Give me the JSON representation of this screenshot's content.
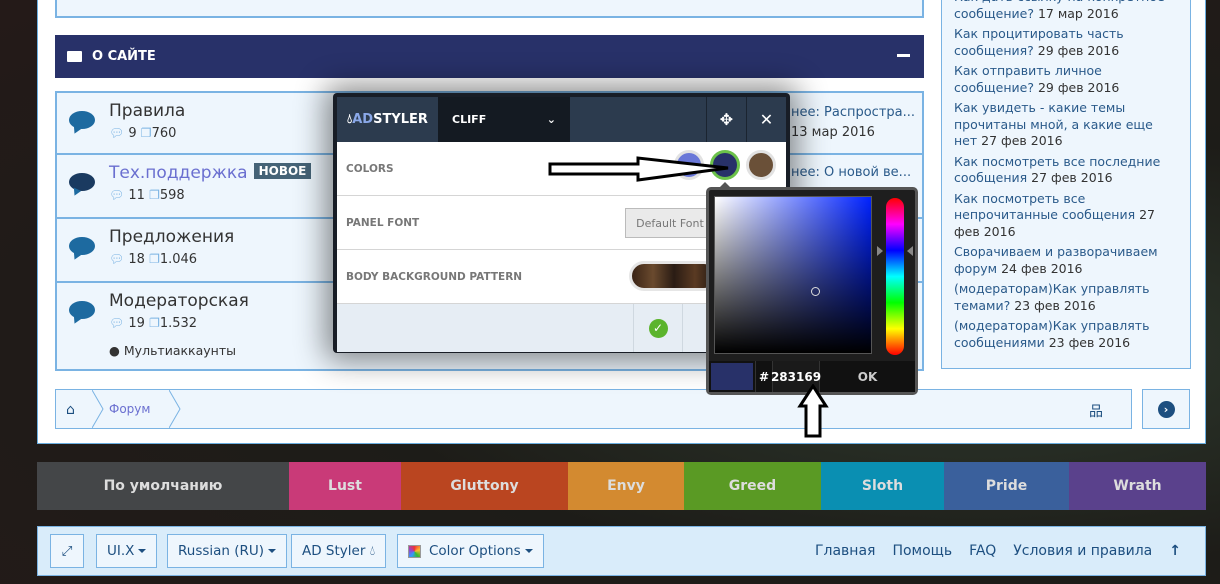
{
  "category": {
    "title": "О САЙТЕ"
  },
  "forums": [
    {
      "title": "Правила",
      "threads": "9",
      "posts": "760",
      "last": "нее: Распростра...",
      "date": "13 мар 2016"
    },
    {
      "title": "Тех.поддержка",
      "badge": "НОВОЕ",
      "threads": "11",
      "posts": "598",
      "last": "нее: О новой ве..."
    },
    {
      "title": "Предложения",
      "threads": "18",
      "posts": "1.046"
    },
    {
      "title": "Модераторская",
      "threads": "19",
      "posts": "1.532",
      "subforum": "Мультиаккаунты"
    }
  ],
  "sidebar": [
    {
      "title": "Как дать ссылку на конкретное сообщение?",
      "date": "17 мар 2016"
    },
    {
      "title": "Как процитировать часть сообщения?",
      "date": "29 фев 2016"
    },
    {
      "title": "Как отправить личное сообщение?",
      "date": "29 фев 2016"
    },
    {
      "title": "Как увидеть - какие темы прочитаны мной, а какие еще нет",
      "date": "27 фев 2016"
    },
    {
      "title": "Как посмотреть все последние сообщения",
      "date": "27 фев 2016"
    },
    {
      "title": "Как посмотреть все непрочитанные сообщения",
      "date": "27 фев 2016"
    },
    {
      "title": "Сворачиваем и разворачиваем форум",
      "date": "24 фев 2016"
    },
    {
      "title": "(модераторам)Как управлять темами?",
      "date": "23 фев 2016"
    },
    {
      "title": "(модераторам)Как управлять сообщениями",
      "date": "23 фев 2016"
    }
  ],
  "breadcrumb": {
    "item": "Форум"
  },
  "styles": [
    {
      "label": "По умолчанию",
      "color": "#444648"
    },
    {
      "label": "Lust",
      "color": "#c93a78"
    },
    {
      "label": "Gluttony",
      "color": "#ba4520"
    },
    {
      "label": "Envy",
      "color": "#d38a30"
    },
    {
      "label": "Greed",
      "color": "#5a9a24"
    },
    {
      "label": "Sloth",
      "color": "#0a8fb2"
    },
    {
      "label": "Pride",
      "color": "#3a609c"
    },
    {
      "label": "Wrath",
      "color": "#5a418c"
    }
  ],
  "footer": {
    "uix": "UI.X",
    "lang": "Russian (RU)",
    "adstyler": "AD Styler",
    "colors": "Color Options",
    "links": [
      "Главная",
      "Помощь",
      "FAQ",
      "Условия и правила"
    ]
  },
  "adstyler": {
    "logo_a": "AD",
    "logo_b": "STYLER",
    "preset": "CLIFF",
    "colors_label": "COLORS",
    "font_label": "PANEL FONT",
    "font_value": "Default Font",
    "pattern_label": "BODY BACKGROUND PATTERN",
    "swatches": [
      "#6a78d8",
      "#283169",
      "#6a5038"
    ]
  },
  "picker": {
    "hash": "#",
    "hex": "283169",
    "ok": "OK",
    "color": "#283169"
  }
}
